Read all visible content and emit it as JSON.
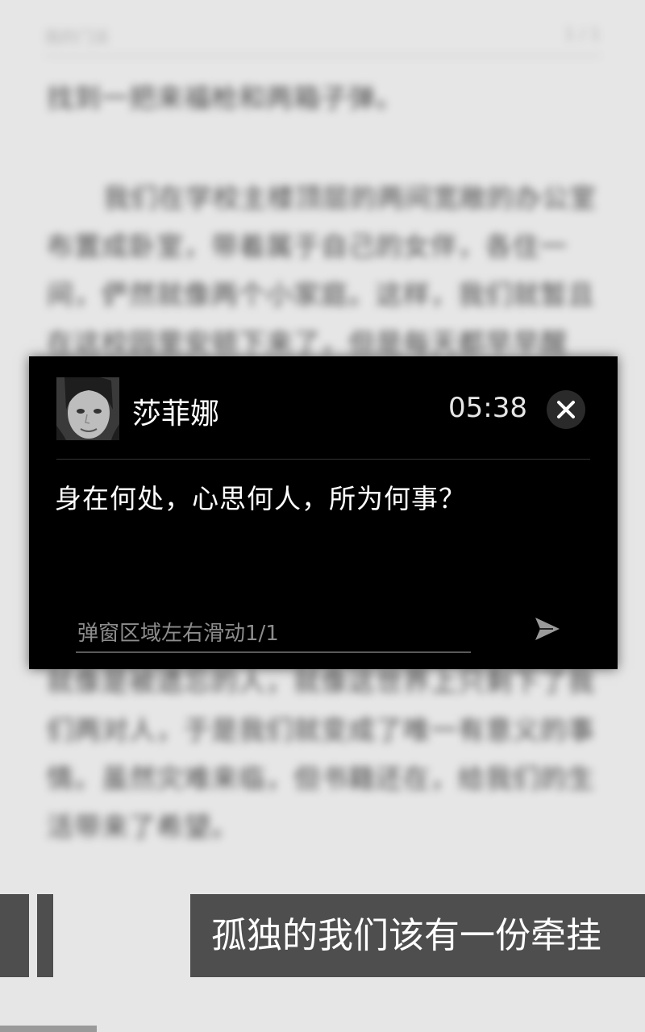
{
  "reader": {
    "header_left": "我的门派",
    "header_right": "1 / 1",
    "paragraph_1": "找到一把来福枪和两箱子弹。",
    "paragraph_2": "我们在学校主楼顶层的两间宽敞的办公室布置成卧室，带着属于自己的女伴，各住一间，俨然就像两个小家庭。这样，我们就暂且在这校园里安顿下来了，但是每天都早早醒来，八点半准时起来参加训练，接着去图书馆看书，准备将来的打算，希望能从书中找到答案，然后走下去。我们要搞明白为什么要学习过这么多没用的东西，想一想这些知识对我们到底有什么用。每天晚上，我们都会讨论并总结自己的收获，期待明天会更好。我们在这里就像是被遗忘的人，就像这世界上只剩下了我们两对人，于是我们就变成了唯一有意义的事情。虽然灾难来临，但书籍还在，给我们的生活带来了希望。"
  },
  "popup": {
    "avatar_alt": "莎菲娜",
    "sender": "莎菲娜",
    "time": "05:38",
    "message": "身在何处，心思何人，所为何事？",
    "input_placeholder": "弹窗区域左右滑动1/1"
  },
  "banner": {
    "text": "孤独的我们该有一份牵挂"
  },
  "colors": {
    "popup_bg": "#000000",
    "banner_bg": "#4e4e4e",
    "page_bg": "#e6e6e6"
  },
  "icons": {
    "close": "close-icon",
    "send": "send-icon"
  }
}
